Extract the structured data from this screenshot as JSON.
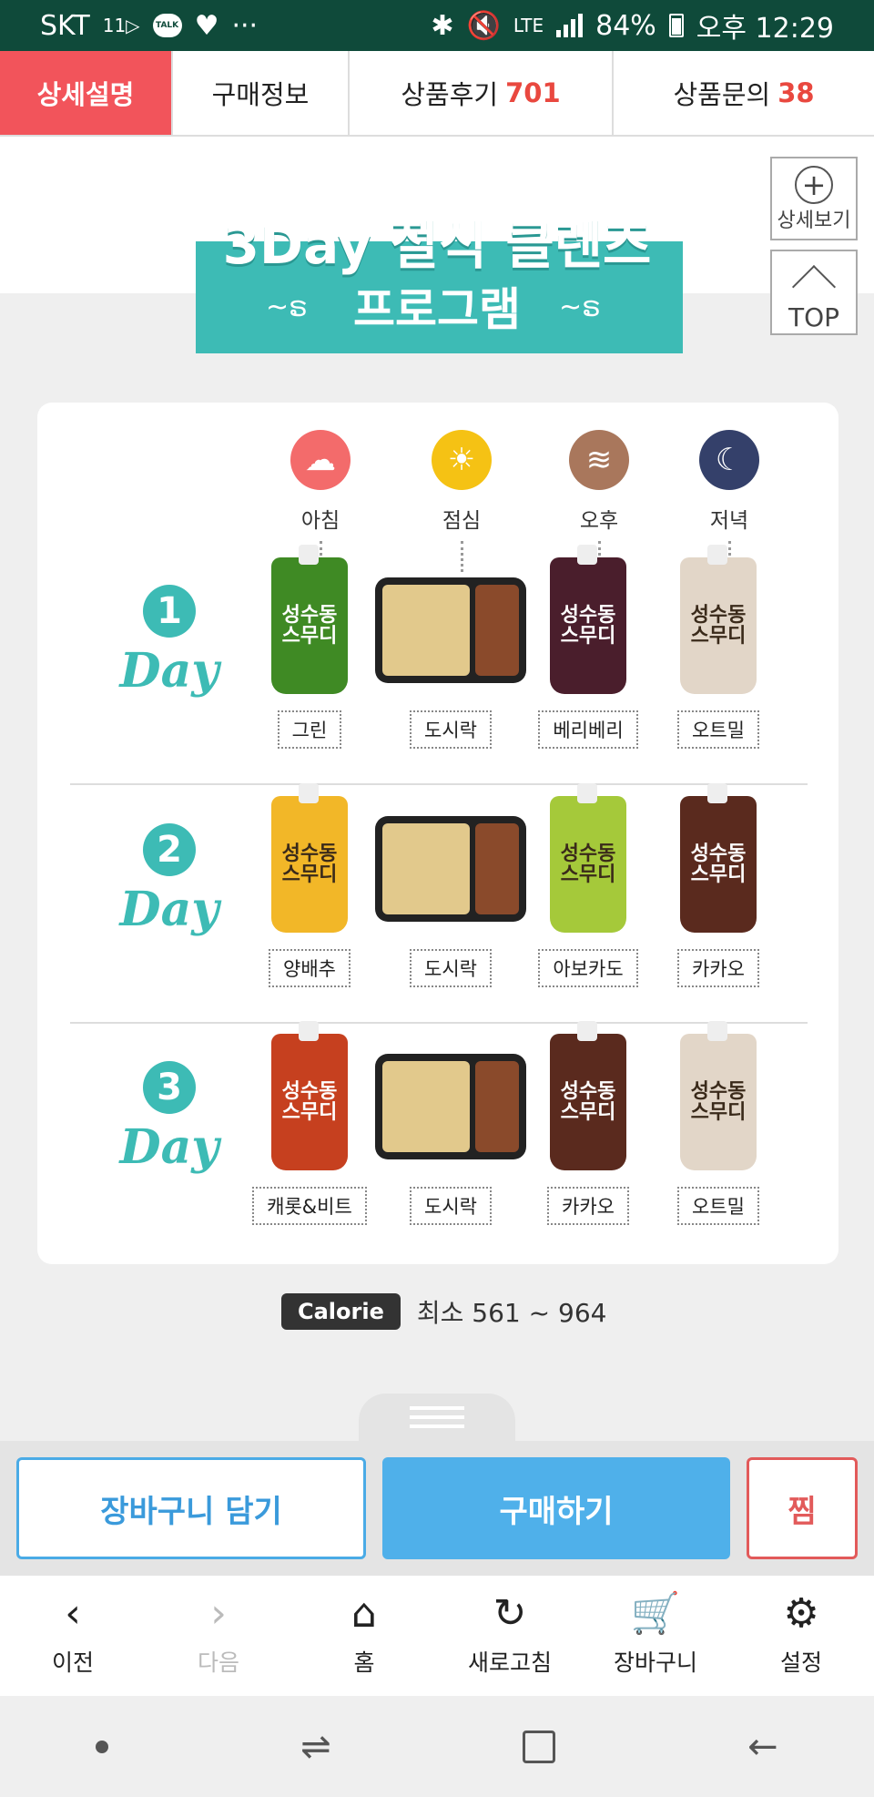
{
  "status_bar": {
    "carrier": "SKT",
    "carrier_sub": "11▷",
    "talk": "TALK",
    "more": "···",
    "network": "LTE",
    "battery": "84%",
    "time": "오후 12:29"
  },
  "tabs": [
    {
      "label": "상세설명",
      "count": ""
    },
    {
      "label": "구매정보",
      "count": ""
    },
    {
      "label": "상품후기",
      "count": "701"
    },
    {
      "label": "상품문의",
      "count": "38"
    }
  ],
  "side": {
    "detail_label": "상세보기",
    "top_label": "TOP"
  },
  "banner": {
    "line1": "3Day 절식 클렌즈",
    "line2": "프로그램"
  },
  "schedule": {
    "times": [
      {
        "label": "아침",
        "icon": "cloud-sun-icon",
        "color": "#f36b6b"
      },
      {
        "label": "점심",
        "icon": "sun-icon",
        "color": "#f5c214"
      },
      {
        "label": "오후",
        "icon": "sunset-icon",
        "color": "#a9775c"
      },
      {
        "label": "저녁",
        "icon": "moon-icon",
        "color": "#34406a"
      }
    ],
    "days": [
      {
        "num": "1",
        "word": "Day",
        "items": [
          {
            "label": "그린",
            "kind": "pouch",
            "color": "#3f8a24",
            "text": "성수동\n스무디"
          },
          {
            "label": "도시락",
            "kind": "box"
          },
          {
            "label": "베리베리",
            "kind": "pouch",
            "color": "#4a1e2c",
            "text": "성수동\n스무디"
          },
          {
            "label": "오트밀",
            "kind": "pouch",
            "color": "#e2d6c8",
            "text": "성수동\n스무디"
          }
        ]
      },
      {
        "num": "2",
        "word": "Day",
        "items": [
          {
            "label": "양배추",
            "kind": "pouch",
            "color": "#f2b728",
            "text": "성수동\n스무디"
          },
          {
            "label": "도시락",
            "kind": "box"
          },
          {
            "label": "아보카도",
            "kind": "pouch",
            "color": "#a5c93a",
            "text": "성수동\n스무디"
          },
          {
            "label": "카카오",
            "kind": "pouch",
            "color": "#5a2a1e",
            "text": "성수동\n스무디"
          }
        ]
      },
      {
        "num": "3",
        "word": "Day",
        "items": [
          {
            "label": "캐롯&비트",
            "kind": "pouch",
            "color": "#c6401f",
            "text": "성수동\n스무디"
          },
          {
            "label": "도시락",
            "kind": "box"
          },
          {
            "label": "카카오",
            "kind": "pouch",
            "color": "#5a2a1e",
            "text": "성수동\n스무디"
          },
          {
            "label": "오트밀",
            "kind": "pouch",
            "color": "#e2d6c8",
            "text": "성수동\n스무디"
          }
        ]
      }
    ]
  },
  "calorie": {
    "badge": "Calorie",
    "text": "최소 561 ~ 964"
  },
  "actions": {
    "cart": "장바구니 담기",
    "buy": "구매하기",
    "wish": "찜"
  },
  "bottom_nav": [
    {
      "label": "이전",
      "icon": "chevron-left-icon",
      "glyph": "‹",
      "enabled": true
    },
    {
      "label": "다음",
      "icon": "chevron-right-icon",
      "glyph": "›",
      "enabled": false
    },
    {
      "label": "홈",
      "icon": "home-icon",
      "glyph": "⌂",
      "enabled": true
    },
    {
      "label": "새로고침",
      "icon": "refresh-icon",
      "glyph": "↻",
      "enabled": true
    },
    {
      "label": "장바구니",
      "icon": "cart-icon",
      "glyph": "🛒",
      "enabled": true
    },
    {
      "label": "설정",
      "icon": "gear-icon",
      "glyph": "⚙",
      "enabled": true
    }
  ]
}
